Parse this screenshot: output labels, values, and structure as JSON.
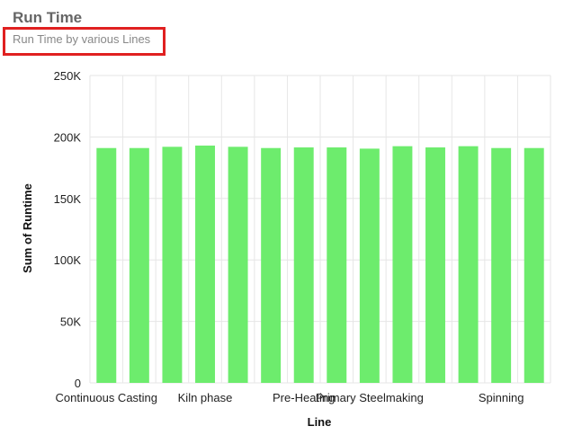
{
  "header": {
    "title": "Run Time",
    "subtitle": "Run Time by various Lines"
  },
  "colors": {
    "bar": "#6dec6d",
    "grid": "#e6e6e6",
    "highlight_box": "#e02020"
  },
  "chart_data": {
    "type": "bar",
    "title": "Run Time",
    "subtitle": "Run Time by various Lines",
    "xlabel": "Line",
    "ylabel": "Sum of Runtime",
    "ylim": [
      0,
      250000
    ],
    "yticks": [
      0,
      50000,
      100000,
      150000,
      200000,
      250000
    ],
    "ytick_labels": [
      "0",
      "50K",
      "100K",
      "150K",
      "200K",
      "250K"
    ],
    "grid": true,
    "categories": [
      "Continuous Casting",
      "",
      "",
      "Kiln phase",
      "",
      "",
      "Pre-Heating",
      "",
      "Primary Steelmaking",
      "",
      "",
      "",
      "Spinning",
      ""
    ],
    "xtick_labels": [
      "Continuous Casting",
      "Kiln phase",
      "Pre-Heating",
      "Primary Steelmaking",
      "Spinning"
    ],
    "series": [
      {
        "values": [
          191000,
          191000,
          192000,
          193000,
          192000,
          191000,
          191500,
          191500,
          190500,
          192500,
          191500,
          192500,
          191000,
          191000
        ]
      }
    ]
  }
}
